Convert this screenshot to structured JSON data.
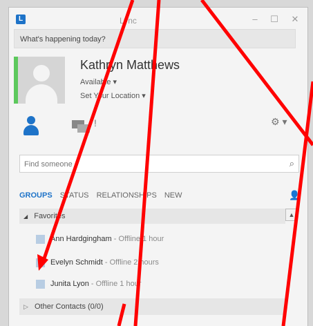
{
  "window": {
    "title": "Lync",
    "minimize": "–",
    "maximize": "☐",
    "close": "✕"
  },
  "status_banner": "What's happening today?",
  "profile": {
    "name": "Kathryn Matthews",
    "availability": "Available ▾",
    "location": "Set Your Location ▾"
  },
  "search": {
    "placeholder": "Find someone"
  },
  "tabs": [
    "GROUPS",
    "STATUS",
    "RELATIONSHIPS",
    "NEW"
  ],
  "groups": {
    "favorites_label": "Favorites",
    "other_contacts_label": "Other Contacts (0/0)"
  },
  "contacts": [
    {
      "name": "Ann Hardgingham",
      "status": "- Offline 1 hour"
    },
    {
      "name": "Evelyn Schmidt",
      "status": "- Offline 2 hours"
    },
    {
      "name": "Junita Lyon",
      "status": "- Offline 1 hour"
    }
  ],
  "colors": {
    "accent": "#1e73c8",
    "presence_available": "#5cc85c",
    "annotation_red": "#ff0000"
  }
}
